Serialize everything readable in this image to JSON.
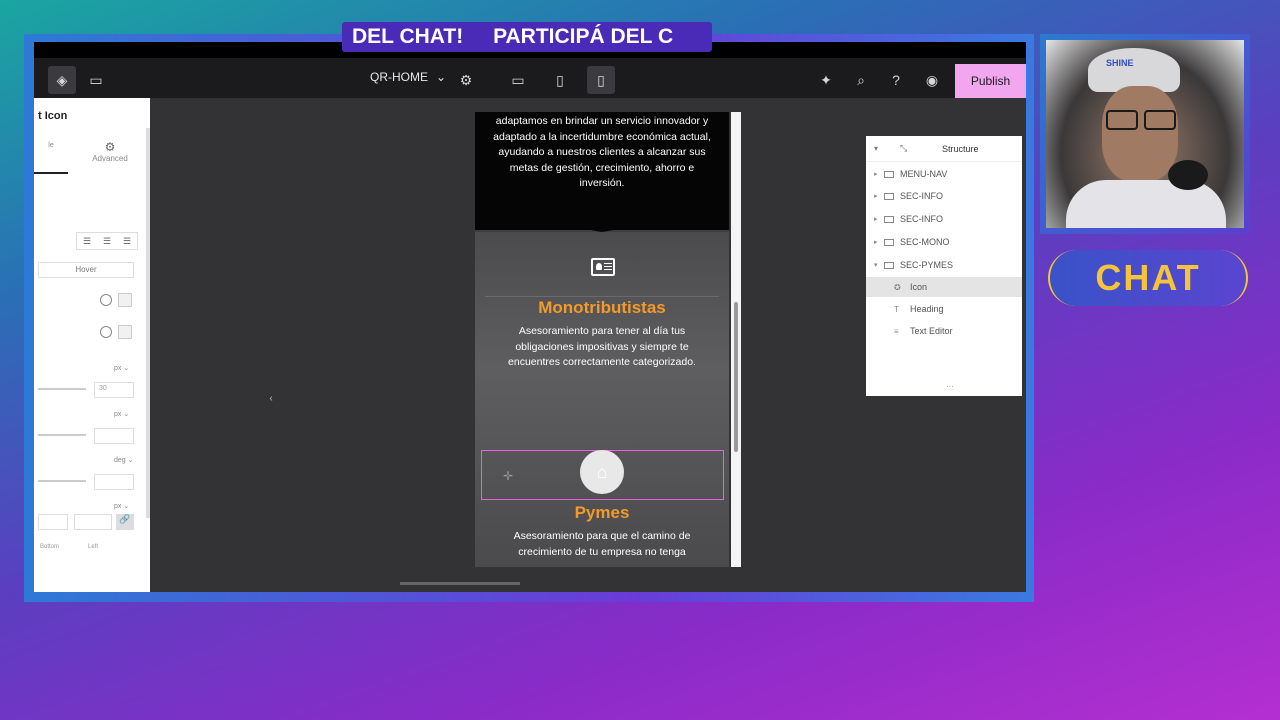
{
  "marquee": {
    "text_1": "DEL CHAT!",
    "text_2": "PARTICIPÁ DEL C"
  },
  "topbar": {
    "site_name": "QR-HOME",
    "publish_label": "Publish"
  },
  "left_panel": {
    "title": "t Icon",
    "tab_style": "le",
    "tab_advanced": "Advanced",
    "hover_tab": "Hover",
    "size_unit_1": "px ⌄",
    "size_value_1": "30",
    "size_unit_2": "px ⌄",
    "rotate_unit": "deg ⌄",
    "padding_unit": "px ⌄",
    "label_bottom": "Bottom",
    "label_left": "Left"
  },
  "preview": {
    "intro_text": "adaptamos en brindar un servicio innovador y adaptado a la incertidumbre económica actual, ayudando a nuestros clientes a alcanzar sus metas de gestión, crecimiento, ahorro e inversión.",
    "section1_title": "Monotributistas",
    "section1_text": "Asesoramiento para tener al día tus obligaciones impositivas y siempre te encuentres correctamente categorizado.",
    "section2_title": "Pymes",
    "section2_text": "Asesoramiento para que el camino de crecimiento de tu empresa no tenga"
  },
  "structure": {
    "title": "Structure",
    "items": [
      {
        "label": "MENU-NAV"
      },
      {
        "label": "SEC-INFO"
      },
      {
        "label": "SEC-INFO"
      },
      {
        "label": "SEC-MONO"
      },
      {
        "label": "SEC-PYMES"
      }
    ],
    "children": [
      {
        "label": "Icon"
      },
      {
        "label": "Heading"
      },
      {
        "label": "Text Editor"
      }
    ],
    "more": "···"
  },
  "webcam": {
    "cap_text": "SHINE"
  },
  "chat_badge": {
    "label": "CHAT"
  },
  "colors": {
    "accent_orange": "#f39a2a",
    "publish_pink": "#f2a6f0",
    "selection_pink": "#e85fe0",
    "chat_gold": "#f6c43a"
  }
}
